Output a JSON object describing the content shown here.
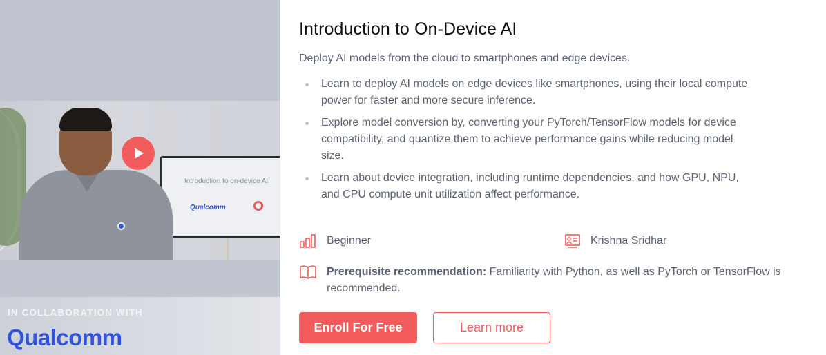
{
  "video": {
    "screen_title": "Introduction to on-device AI",
    "screen_logo": "Qualcomm",
    "play_icon": "play-icon"
  },
  "collab": {
    "label": "IN COLLABORATION WITH",
    "partner_logo": "Qualcomm"
  },
  "course": {
    "title": "Introduction to On-Device AI",
    "subtitle": "Deploy AI models from the cloud to smartphones and edge devices.",
    "bullets": [
      "Learn to deploy AI models on edge devices like smartphones, using their local compute power for faster and more secure inference.",
      "Explore model conversion by, converting your PyTorch/TensorFlow models for device compatibility, and quantize them to achieve performance gains while reducing model size.",
      "Learn about device integration, including runtime dependencies, and how GPU, NPU, and CPU compute unit utilization affect performance."
    ],
    "level": "Beginner",
    "instructor": "Krishna Sridhar",
    "prereq_label": "Prerequisite recommendation:",
    "prereq_text": " Familiarity with Python, as well as PyTorch or TensorFlow is recommended."
  },
  "actions": {
    "enroll_label": "Enroll For Free",
    "learn_label": "Learn more"
  },
  "colors": {
    "accent": "#f25c5c",
    "text_muted": "#5a6273",
    "partner_blue": "#3253dc"
  }
}
